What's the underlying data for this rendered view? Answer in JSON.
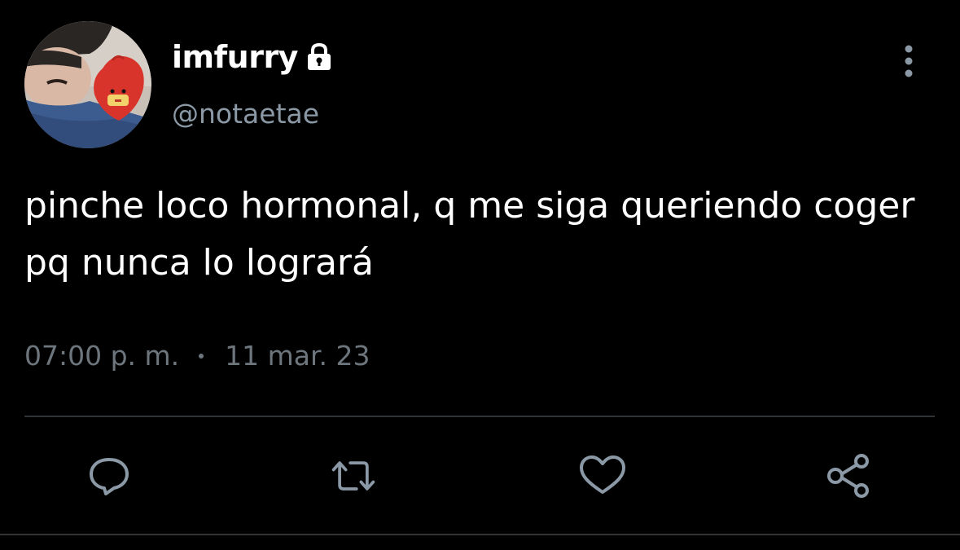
{
  "user": {
    "display_name": "imfurry",
    "handle": "@notaetae",
    "protected": true,
    "avatar": "profile-photo"
  },
  "tweet": {
    "text": "pinche loco hormonal, q me siga queriendo coger pq nunca lo logrará",
    "time": "07:00 p. m.",
    "date": "11 mar. 23"
  },
  "actions": [
    {
      "name": "reply",
      "icon": "comment-bubble-icon"
    },
    {
      "name": "retweet",
      "icon": "retweet-arrows-icon"
    },
    {
      "name": "like",
      "icon": "heart-icon"
    },
    {
      "name": "share",
      "icon": "share-nodes-icon"
    }
  ],
  "colors": {
    "background": "#000000",
    "primary_text": "#ffffff",
    "secondary_text": "#8b98a5",
    "meta_text": "#6e767d",
    "icon": "#8b98a5",
    "divider": "#2f3336"
  }
}
